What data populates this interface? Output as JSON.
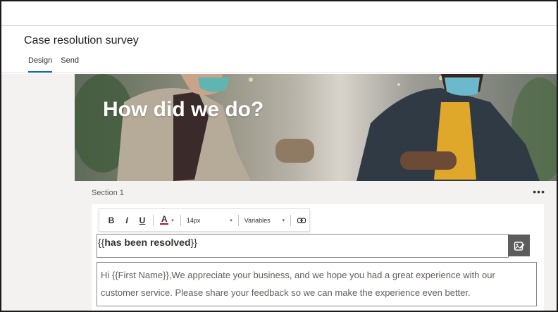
{
  "header": {
    "title": "Case resolution survey",
    "tabs": [
      {
        "label": "Design",
        "active": true
      },
      {
        "label": "Send",
        "active": false
      }
    ]
  },
  "hero": {
    "title": "How did we do?"
  },
  "section": {
    "label": "Section 1",
    "more_label": "•••"
  },
  "toolbar": {
    "bold_label": "B",
    "italic_label": "I",
    "underline_label": "U",
    "font_color_label": "A",
    "font_size": "14px",
    "variables_label": "Variables"
  },
  "question": {
    "heading_prefix": "{{",
    "heading_variable": "has been resolved",
    "heading_suffix": "}}",
    "body": "Hi {{First Name}},We appreciate your business, and we hope you had a great experience with our customer service. Please share your feedback so we can make the experience even better."
  },
  "colors": {
    "accent": "#0f6cbd",
    "canvas_bg": "#f3f2f1",
    "edit_button": "#5c5c5c"
  },
  "icons": {
    "font_color": "font-color-icon",
    "link": "link-icon",
    "edit": "edit-image-icon",
    "more": "more-icon"
  }
}
